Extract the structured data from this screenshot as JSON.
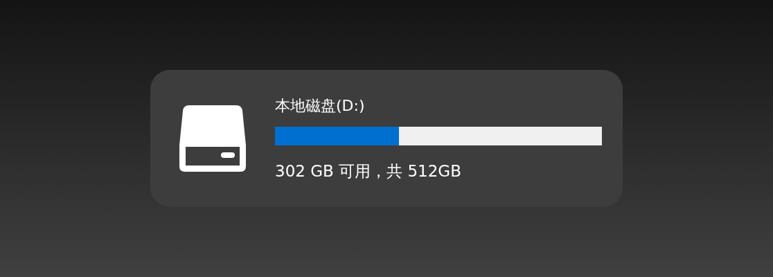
{
  "drive": {
    "name": "本地磁盘(D:)",
    "level": 0.38,
    "summary": "302 GB 可用，共 512GB"
  }
}
